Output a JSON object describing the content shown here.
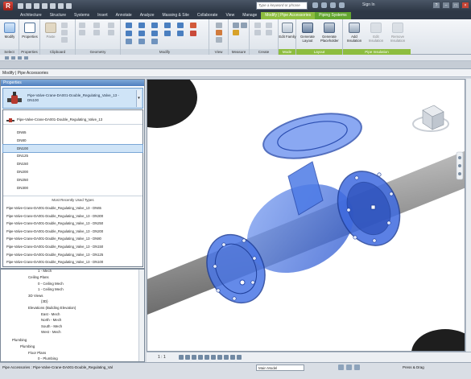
{
  "titlebar": {
    "app_letter": "R",
    "search_placeholder": "Type a keyword or phrase",
    "signin_label": "Sign In"
  },
  "tabs": [
    {
      "label": "Architecture"
    },
    {
      "label": "Structure"
    },
    {
      "label": "Systems"
    },
    {
      "label": "Insert"
    },
    {
      "label": "Annotate"
    },
    {
      "label": "Analyze"
    },
    {
      "label": "Massing & Site"
    },
    {
      "label": "Collaborate"
    },
    {
      "label": "View"
    },
    {
      "label": "Manage"
    },
    {
      "label": "Modify | Pipe Accessories"
    },
    {
      "label": "Piping Systems"
    }
  ],
  "ribbon": {
    "modify_label": "Modify",
    "properties_label": "Properties",
    "paste_label": "Paste",
    "panels": {
      "select": "Select",
      "properties": "Properties",
      "clipboard": "Clipboard",
      "geometry": "Geometry",
      "modify": "Modify",
      "view": "View",
      "measure": "Measure",
      "create": "Create",
      "mode": "Mode",
      "layout": "Layout",
      "pipe_insulation": "Pipe Insulation"
    },
    "cut_label": "Cut",
    "join_label": "Join",
    "edit_family_label": "Edit Family",
    "generate_layout_label": "Generate Layout",
    "generate_placeholder_label": "Generate Placeholder",
    "add_insulation_label": "Add Insulation",
    "edit_insulation_label": "Edit Insulation",
    "remove_insulation_label": "Remove Insulation"
  },
  "modebar": {
    "label": "Modify | Pipe Accessories"
  },
  "properties": {
    "header": "Properties",
    "type_name": "Pipe-Valve-Crane-DA001-Double_Regulating_Valve_13 - DN100",
    "family_name": "Pipe-Valve-Crane-DA001-Double_Regulating_Valve_13",
    "sizes": [
      "DN65",
      "DN80",
      "DN100",
      "DN125",
      "DN150",
      "DN200",
      "DN250",
      "DN300"
    ],
    "selected_size": "DN100",
    "mru_header": "Most Recently Used Types",
    "mru": [
      "Pipe-Valve-Crane-DA001-Double_Regulating_Valve_13 - DN65",
      "Pipe-Valve-Crane-DA001-Double_Regulating_Valve_13 - DN300",
      "Pipe-Valve-Crane-DA001-Double_Regulating_Valve_13 - DN250",
      "Pipe-Valve-Crane-DA001-Double_Regulating_Valve_13 - DN200",
      "Pipe-Valve-Crane-DA001-Double_Regulating_Valve_13 - DN80",
      "Pipe-Valve-Crane-DA001-Double_Regulating_Valve_13 - DN150",
      "Pipe-Valve-Crane-DA001-Double_Regulating_Valve_13 - DN125",
      "Pipe-Valve-Crane-DA001-Double_Regulating_Valve_13 - DN100"
    ]
  },
  "browser": {
    "items": [
      "1 - Mech",
      "Ceiling Plans",
      "0 - Ceiling Mech",
      "1 - Ceiling Mech",
      "3D Views",
      "{3D}",
      "Elevations (Building Elevation)",
      "East - Mech",
      "North - Mech",
      "South - Mech",
      "West - Mech",
      "Plumbing",
      "Plumbing",
      "Floor Plans",
      "0 - Plumbing"
    ]
  },
  "viewbar": {
    "scale": "1 : 1"
  },
  "status": {
    "text": "Pipe Accessories : Pipe-Valve-Crane-DA001-Double_Regulating_Val",
    "model": "Main Model",
    "press_drag": "Press & Drag"
  },
  "colors": {
    "context_tab": "#8dbd3f",
    "valve_blue": "#3d6fe0",
    "pipe_gray": "#9a9a9a",
    "selection": "#cfe4f7"
  }
}
